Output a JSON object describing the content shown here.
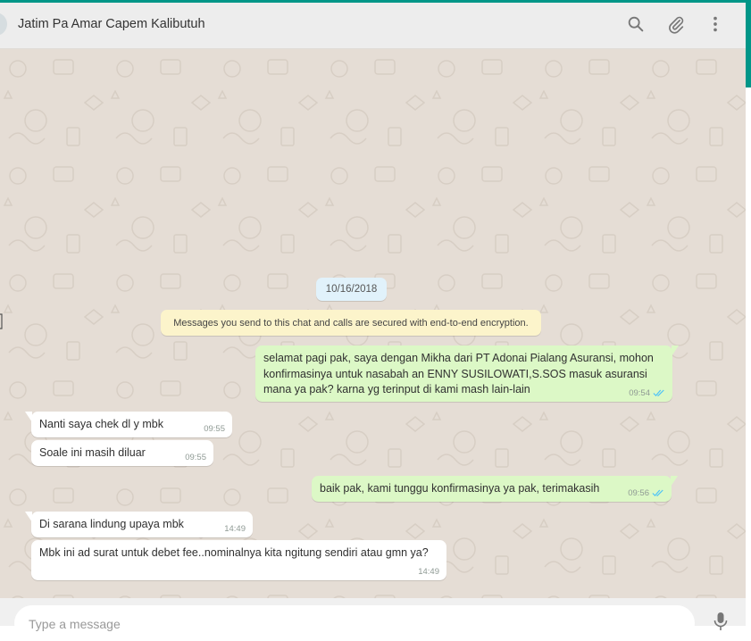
{
  "header": {
    "title": "Jatim Pa Amar Capem Kalibutuh",
    "icons": [
      "search-icon",
      "paperclip-icon",
      "kebab-menu-icon"
    ]
  },
  "chat": {
    "date": "10/16/2018",
    "encryption_notice": "Messages you send to this chat and calls are secured with end-to-end encryption.",
    "messages": [
      {
        "direction": "outgoing",
        "lines": [
          "selamat pagi pak, saya dengan Mikha dari PT Adonai Pialang Asuransi, mohon",
          "konfirmasinya untuk nasabah an ENNY SUSILOWATI,S.SOS masuk asuransi",
          "mana ya pak? karna yg terinput di kami mash lain-lain"
        ],
        "time": "09:54",
        "status": "read"
      },
      {
        "direction": "incoming",
        "lines": [
          "Nanti saya chek dl y mbk"
        ],
        "time": "09:55"
      },
      {
        "direction": "incoming",
        "lines": [
          "Soale ini masih diluar"
        ],
        "time": "09:55"
      },
      {
        "direction": "outgoing",
        "lines": [
          "baik pak, kami tunggu konfirmasinya ya pak, terimakasih"
        ],
        "time": "09:56",
        "status": "read"
      },
      {
        "direction": "incoming",
        "lines": [
          "Di sarana lindung upaya mbk"
        ],
        "time": "14:49"
      },
      {
        "direction": "incoming",
        "lines": [
          "Mbk ini ad surat untuk debet fee..nominalnya kita ngitung sendiri atau gmn ya?"
        ],
        "time": "14:49"
      }
    ]
  },
  "composer": {
    "placeholder": "Type a message",
    "value": ""
  },
  "colors": {
    "accent": "#009688",
    "outgoing_bubble": "#dcf8c6",
    "incoming_bubble": "#ffffff",
    "chat_background": "#e5ddd5",
    "read_tick": "#4fc3f7"
  }
}
